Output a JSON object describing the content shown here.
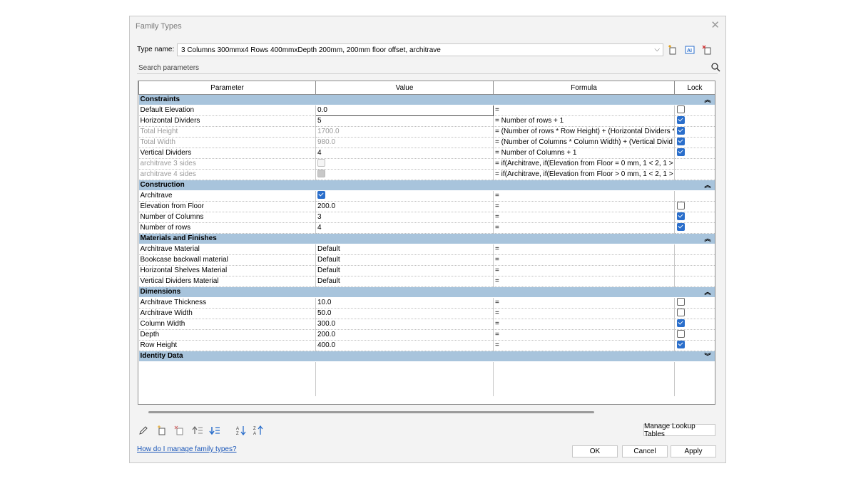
{
  "dialog": {
    "title": "Family Types",
    "type_name_label": "Type name:",
    "type_name_value": "3 Columns 300mmx4 Rows 400mmxDepth 200mm, 200mm floor offset, architrave",
    "search_placeholder": "Search parameters"
  },
  "table": {
    "headers": [
      "Parameter",
      "Value",
      "Formula",
      "Lock"
    ],
    "groups": [
      {
        "name": "Constraints",
        "rows": [
          {
            "param": "Default Elevation",
            "value": "0.0",
            "formula": "=",
            "lock": "off",
            "editing": true
          },
          {
            "param": "Horizontal Dividers",
            "value": "5",
            "formula": "= Number of rows + 1",
            "lock": "on"
          },
          {
            "param": "Total Height",
            "value": "1700.0",
            "formula": "= (Number of rows * Row Height) + (Horizontal Dividers *",
            "lock": "on",
            "disabled": true
          },
          {
            "param": "Total Width",
            "value": "980.0",
            "formula": "= (Number of Columns * Column Width) + (Vertical Divid",
            "lock": "on",
            "disabled": true
          },
          {
            "param": "Vertical Dividers",
            "value": "4",
            "formula": "= Number of Columns + 1",
            "lock": "on"
          },
          {
            "param": "architrave 3 sides",
            "value": "",
            "value_checkbox": "dis",
            "formula": "= if(Architrave, if(Elevation from Floor = 0 mm, 1 < 2, 1 >",
            "lock": "none",
            "disabled": true
          },
          {
            "param": "architrave 4 sides",
            "value": "",
            "value_checkbox": "dison",
            "formula": "= if(Architrave, if(Elevation from Floor > 0 mm, 1 < 2, 1 >",
            "lock": "none",
            "disabled": true
          }
        ]
      },
      {
        "name": "Construction",
        "rows": [
          {
            "param": "Architrave",
            "value": "",
            "value_checkbox": "on",
            "formula": "=",
            "lock": "none"
          },
          {
            "param": "Elevation from Floor",
            "value": "200.0",
            "formula": "=",
            "lock": "off"
          },
          {
            "param": "Number of Columns",
            "value": "3",
            "formula": "=",
            "lock": "on"
          },
          {
            "param": "Number of rows",
            "value": "4",
            "formula": "=",
            "lock": "on"
          }
        ]
      },
      {
        "name": "Materials and Finishes",
        "rows": [
          {
            "param": "Architrave Material",
            "value": "Default",
            "formula": "=",
            "lock": "none"
          },
          {
            "param": "Bookcase backwall material",
            "value": "Default",
            "formula": "=",
            "lock": "none"
          },
          {
            "param": "Horizontal Shelves Material",
            "value": "Default",
            "formula": "=",
            "lock": "none"
          },
          {
            "param": "Vertical Dividers Material",
            "value": "Default",
            "formula": "=",
            "lock": "none"
          }
        ]
      },
      {
        "name": "Dimensions",
        "rows": [
          {
            "param": "Architrave Thickness",
            "value": "10.0",
            "formula": "=",
            "lock": "off"
          },
          {
            "param": "Architrave Width",
            "value": "50.0",
            "formula": "=",
            "lock": "off"
          },
          {
            "param": "Column Width",
            "value": "300.0",
            "formula": "=",
            "lock": "on"
          },
          {
            "param": "Depth",
            "value": "200.0",
            "formula": "=",
            "lock": "off"
          },
          {
            "param": "Row Height",
            "value": "400.0",
            "formula": "=",
            "lock": "on"
          }
        ]
      },
      {
        "name": "Identity Data",
        "collapsed": true,
        "rows": []
      }
    ]
  },
  "footer": {
    "manage_lookup_label": "Manage Lookup Tables",
    "help_link": "How do I manage family types?",
    "ok_label": "OK",
    "cancel_label": "Cancel",
    "apply_label": "Apply"
  },
  "colors": {
    "group_header": "#a8c4dc",
    "checkbox_on": "#2a6ecb",
    "link": "#1a56b8"
  },
  "icons": {
    "toolbar": [
      "new-type-icon",
      "rename-type-icon",
      "delete-type-icon"
    ],
    "bottom_tools": [
      "edit-parameter-icon",
      "new-parameter-icon",
      "delete-parameter-icon",
      "move-up-icon",
      "move-down-icon",
      "sort-ascending-icon",
      "sort-descending-icon"
    ]
  }
}
